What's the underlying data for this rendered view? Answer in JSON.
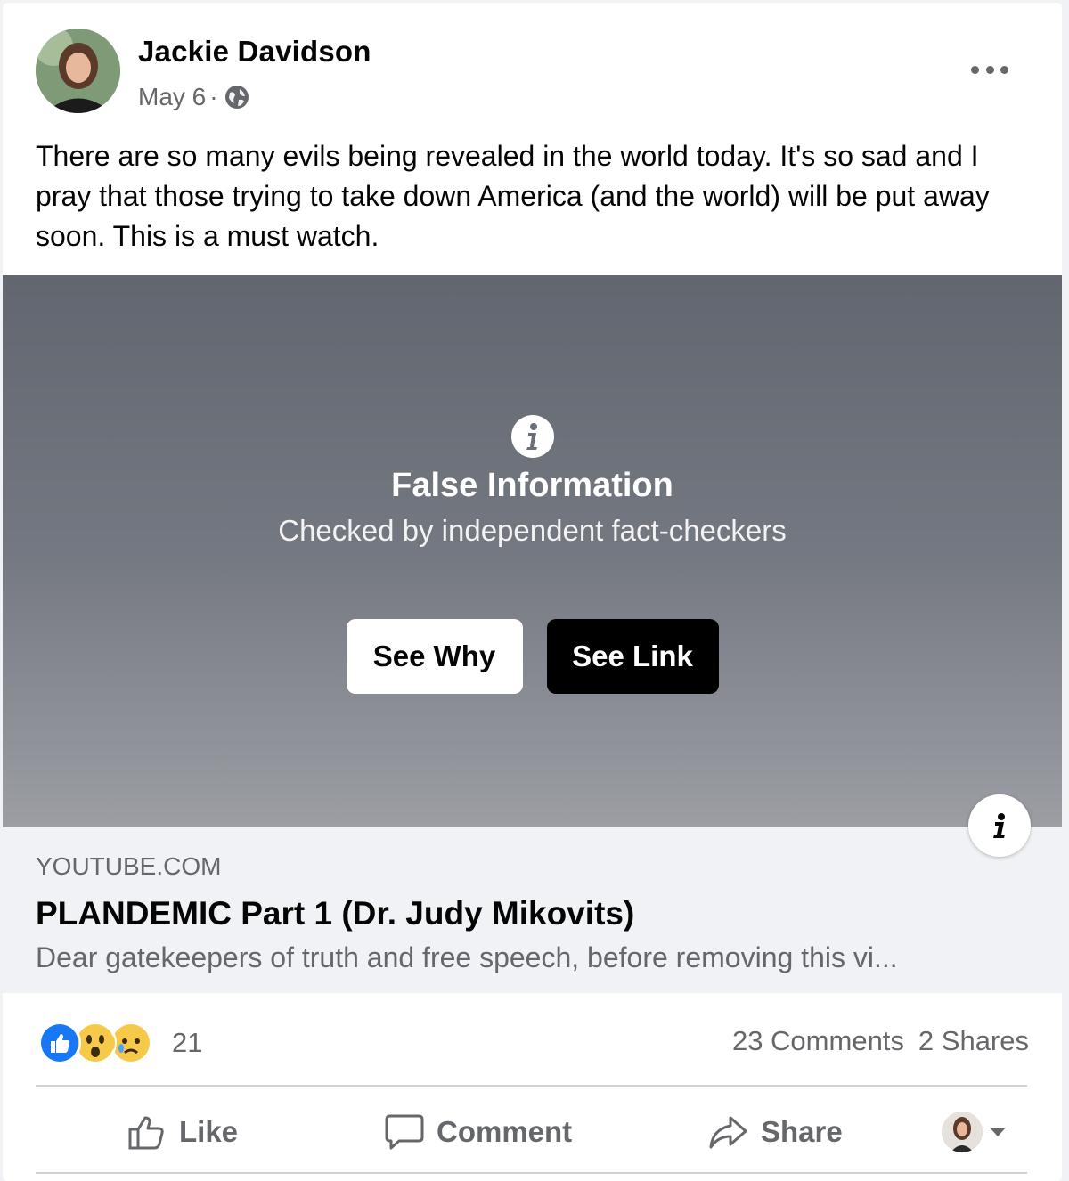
{
  "post": {
    "author": "Jackie Davidson",
    "date": "May 6",
    "date_separator": "·",
    "audience_icon": "globe-icon",
    "more_icon": "more-options-icon",
    "text": "There are so many evils being revealed in the world today. It's so sad and I pray that those trying to take down America (and the world) will be put away soon. This is a must watch."
  },
  "fact_check": {
    "icon": "info-icon",
    "title": "False Information",
    "subtitle": "Checked by independent fact-checkers",
    "see_why_label": "See Why",
    "see_link_label": "See Link"
  },
  "link_preview": {
    "domain": "YOUTUBE.COM",
    "title": "PLANDEMIC Part 1 (Dr. Judy Mikovits)",
    "description": "Dear gatekeepers of truth and free speech, before removing this vi..."
  },
  "stats": {
    "reactions": [
      "like",
      "wow",
      "sad"
    ],
    "reaction_count": "21",
    "comments": "23 Comments",
    "shares": "2 Shares"
  },
  "actions": {
    "like": "Like",
    "comment": "Comment",
    "share": "Share"
  },
  "colors": {
    "like_blue": "#1877f2",
    "emoji_yellow": "#f7c94b",
    "text_secondary": "#65676b"
  }
}
